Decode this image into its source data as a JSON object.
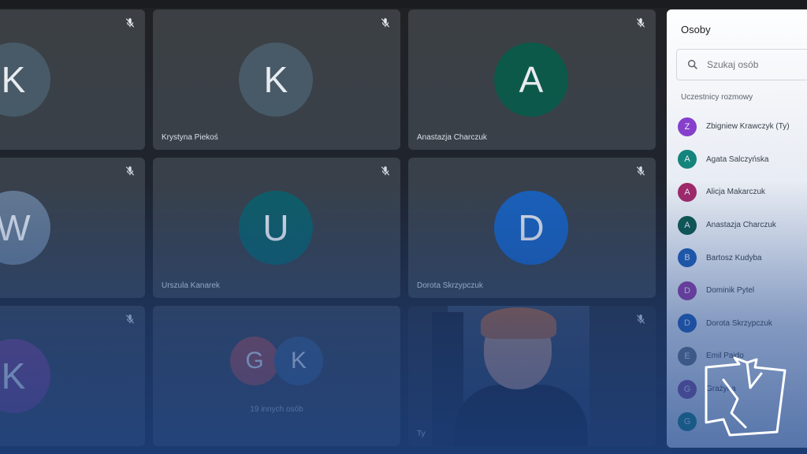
{
  "grid": {
    "tiles": [
      {
        "id": "t1",
        "name": "",
        "initial": "K",
        "avatar_color": "#4a5b66",
        "muted": true
      },
      {
        "id": "t2",
        "name": "Krystyna Piekoś",
        "initial": "K",
        "avatar_color": "#4a5b66",
        "muted": true
      },
      {
        "id": "t3",
        "name": "Anastazja Charczuk",
        "initial": "A",
        "avatar_color": "#0b5a47",
        "muted": true
      },
      {
        "id": "t4",
        "name": "",
        "initial": "W",
        "avatar_color": "#6d7f92",
        "muted": true
      },
      {
        "id": "t5",
        "name": "Urszula Kanarek",
        "initial": "U",
        "avatar_color": "#0d6062",
        "muted": true
      },
      {
        "id": "t6",
        "name": "Dorota Skrzypczuk",
        "initial": "D",
        "avatar_color": "#1a63bf",
        "muted": true
      },
      {
        "id": "t7",
        "name": "",
        "initial": "K",
        "avatar_color": "#7a3f7a",
        "muted": true
      },
      {
        "id": "t9",
        "name": "Ty",
        "muted": true
      }
    ],
    "others_tile": {
      "initials": [
        "G",
        "K"
      ],
      "colors": [
        "#a9473f",
        "#3f5978"
      ],
      "label": "19 innych osób"
    }
  },
  "panel": {
    "title": "Osoby",
    "search_placeholder": "Szukaj osób",
    "section_label": "Uczestnicy rozmowy",
    "participants": [
      {
        "initial": "Z",
        "name": "Zbigniew Krawczyk (Ty)",
        "color": "#8e3fd1"
      },
      {
        "initial": "A",
        "name": "Agata Salczyńska",
        "color": "#138a7a"
      },
      {
        "initial": "A",
        "name": "Alicja Makarczuk",
        "color": "#b02565"
      },
      {
        "initial": "A",
        "name": "Anastazja Charczuk",
        "color": "#0b5a47"
      },
      {
        "initial": "B",
        "name": "Bartosz Kudyba",
        "color": "#1f5fb7"
      },
      {
        "initial": "D",
        "name": "Dominik Pytel",
        "color": "#9f3aa6"
      },
      {
        "initial": "D",
        "name": "Dorota Skrzypczuk",
        "color": "#1f5fb7"
      },
      {
        "initial": "E",
        "name": "Emil Pajdo",
        "color": "#6f7680"
      },
      {
        "initial": "G",
        "name": "Grażyna",
        "color": "#8c4f9a"
      },
      {
        "initial": "G",
        "name": "",
        "color": "#138a7a"
      }
    ]
  },
  "colors": {
    "overlay_blue": "#1b448c",
    "tile_bg": "#3c4043"
  },
  "icons": {
    "mic": "mic-off-icon",
    "search": "search-icon",
    "logo": "hand-logo-icon"
  }
}
